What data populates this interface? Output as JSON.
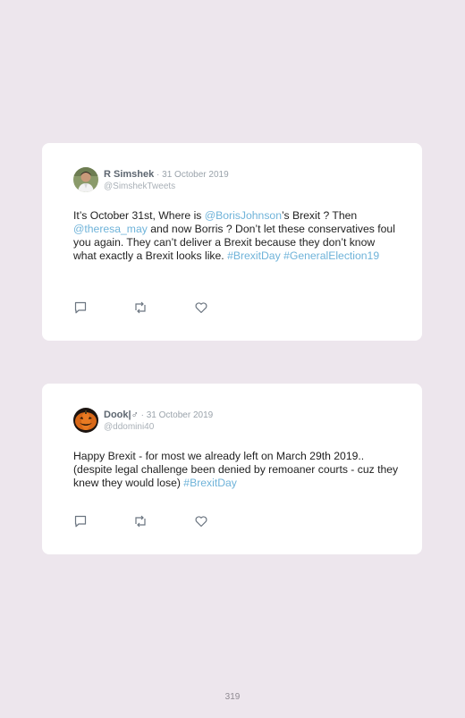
{
  "tweets": [
    {
      "name": "R Simshek",
      "date": " · 31 October 2019",
      "handle": "@SimshekTweets",
      "text": [
        "It’s October 31st, Where is ",
        "@BorisJohnson",
        "’s Brexit ? Then ",
        "@theresa_may",
        " and now Borris ? Don’t let these conservatives foul you again. They can’t deliver a Brexit because they don’t know what exactly a Brexit looks like. ",
        "#BrexitDay",
        " ",
        "#GeneralElection19"
      ],
      "avatar_icon": "man-avatar"
    },
    {
      "name": "Dook|♂",
      "date": " · 31 October 2019",
      "handle": "@ddomini40",
      "text": [
        "Happy Brexit - for most we already left on March 29th 2019.. (despite legal challenge been denied by remoaner courts - cuz they knew they would lose) ",
        "#BrexitDay"
      ],
      "avatar_icon": "pumpkin-avatar"
    }
  ],
  "page_number": "319",
  "colors": {
    "link": "#6fb3d9",
    "background": "#ede6ed"
  }
}
